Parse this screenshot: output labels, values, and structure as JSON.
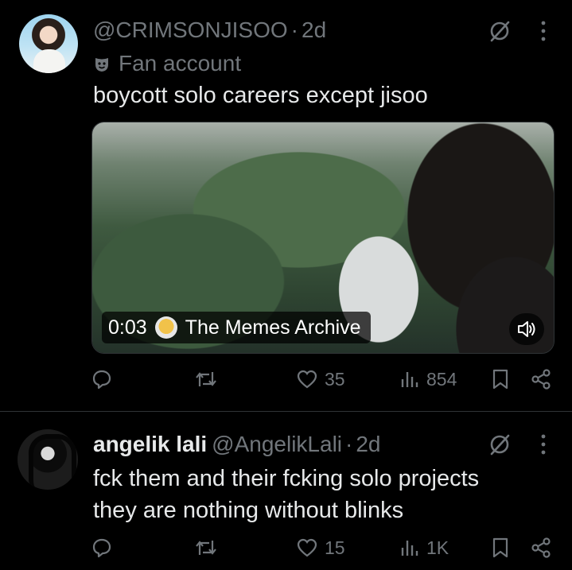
{
  "tweets": [
    {
      "handle": "@CRIMSONJISOO",
      "separator": "·",
      "time": "2d",
      "label": "Fan account",
      "text": "boycott solo careers except jisoo",
      "media": {
        "video_time": "0:03",
        "source": "The Memes Archive"
      },
      "stats": {
        "replies": "",
        "reposts": "",
        "likes": "35",
        "views": "854"
      }
    },
    {
      "name": "angelik lali",
      "handle": "@AngelikLali",
      "separator": "·",
      "time": "2d",
      "text_line1": "fck them and their fcking solo projects",
      "text_line2": "they are nothing without blinks",
      "stats": {
        "replies": "",
        "reposts": "",
        "likes": "15",
        "views": "1K"
      }
    }
  ],
  "icons": {
    "grok": "grok-icon",
    "more": "more-icon",
    "reply": "reply-icon",
    "repost": "repost-icon",
    "like": "heart-icon",
    "views": "views-icon",
    "bookmark": "bookmark-icon",
    "share": "share-icon",
    "fan": "mask-icon",
    "volume": "volume-icon"
  },
  "colors": {
    "background": "#000000",
    "text": "#e7e9ea",
    "muted": "#71767b",
    "divider": "#2f3336"
  }
}
